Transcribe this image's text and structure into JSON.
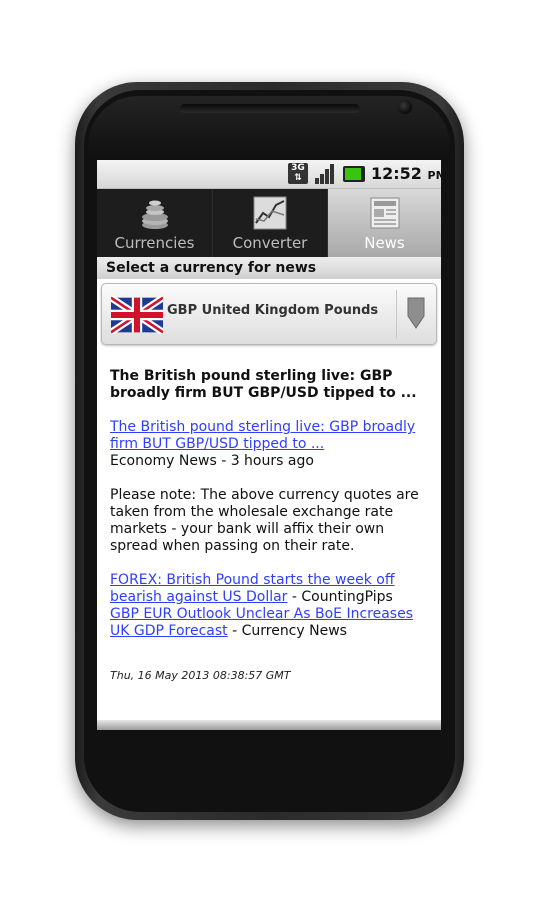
{
  "status_bar": {
    "network": "3G",
    "time": "12:52",
    "ampm": "PM"
  },
  "tabs": [
    {
      "label": "Currencies",
      "icon": "coins-icon",
      "selected": false
    },
    {
      "label": "Converter",
      "icon": "chart-icon",
      "selected": false
    },
    {
      "label": "News",
      "icon": "newspaper-icon",
      "selected": true
    }
  ],
  "section_header": "Select a currency for news",
  "currency_selector": {
    "flag": "uk-flag-icon",
    "selected": "GBP United Kingdom Pounds"
  },
  "news": {
    "headline": "The British pound sterling live: GBP broadly firm BUT GBP/USD tipped to ...",
    "link1": "The British pound sterling live: GBP broadly firm BUT GBP/USD tipped to ...",
    "link1_source": "Economy News - 3 hours ago",
    "note": "Please note: The above currency quotes are taken from the wholesale exchange rate markets - your bank will affix their own spread when passing on their rate.",
    "link2": "FOREX: British Pound starts the week off bearish against US Dollar",
    "link2_source": " - CountingPips",
    "link3": "GBP EUR Outlook Unclear As BoE Increases UK GDP Forecast",
    "link3_source": " - Currency News",
    "timestamp": "Thu, 16 May 2013 08:38:57 GMT"
  },
  "colors": {
    "link": "#2f3dff",
    "tabbar": "#1d1d1d",
    "selected_tab": "#bdbdbd",
    "battery": "#39c40f"
  }
}
